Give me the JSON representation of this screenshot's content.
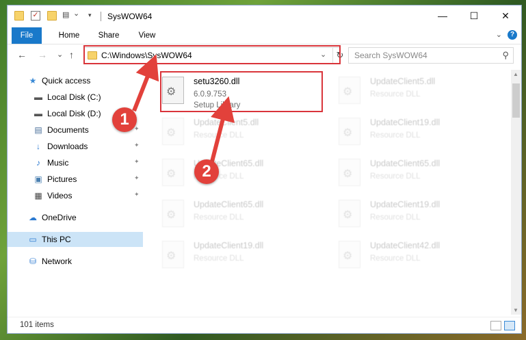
{
  "window": {
    "title": "SysWOW64",
    "minimize_glyph": "—",
    "maximize_glyph": "☐",
    "close_glyph": "✕"
  },
  "quick_access_toolbar": {
    "icons": [
      "folder-icon",
      "properties-check-icon",
      "new-folder-icon",
      "qat-dropdown-icon"
    ]
  },
  "ribbon": {
    "tabs": [
      "File",
      "Home",
      "Share",
      "View"
    ],
    "help_glyph": "?"
  },
  "navigation": {
    "back_glyph": "←",
    "forward_glyph": "→",
    "recent_glyph": "⌄",
    "up_glyph": "↑"
  },
  "address_bar": {
    "path": "C:\\Windows\\SysWOW64",
    "dropdown_glyph": "⌄",
    "refresh_glyph": "↻"
  },
  "search": {
    "placeholder": "Search SysWOW64",
    "icon_glyph": "⚲"
  },
  "sidebar": {
    "items": [
      {
        "label": "Quick access",
        "icon": "star-icon",
        "glyph": "★",
        "color": "#3a8ad6"
      },
      {
        "label": "Local Disk (C:)",
        "icon": "drive-icon",
        "glyph": "▬",
        "color": "#555555"
      },
      {
        "label": "Local Disk (D:)",
        "icon": "drive-icon",
        "glyph": "▬",
        "color": "#555555"
      },
      {
        "label": "Documents",
        "icon": "documents-icon",
        "glyph": "▤",
        "color": "#4a6f9a"
      },
      {
        "label": "Downloads",
        "icon": "download-icon",
        "glyph": "↓",
        "color": "#2b79d0"
      },
      {
        "label": "Music",
        "icon": "music-icon",
        "glyph": "♪",
        "color": "#2b79d0"
      },
      {
        "label": "Pictures",
        "icon": "pictures-icon",
        "glyph": "▣",
        "color": "#4a7fb0"
      },
      {
        "label": "Videos",
        "icon": "videos-icon",
        "glyph": "▦",
        "color": "#444444"
      },
      {
        "label": "OneDrive",
        "icon": "cloud-icon",
        "glyph": "☁",
        "color": "#2b79d0"
      },
      {
        "label": "This PC",
        "icon": "computer-icon",
        "glyph": "▭",
        "color": "#2b79d0"
      },
      {
        "label": "Network",
        "icon": "network-icon",
        "glyph": "⛁",
        "color": "#2b79d0"
      }
    ],
    "pin_glyph": "✦"
  },
  "files": [
    {
      "name": "setu3260.dll",
      "line2": "6.0.9.753",
      "line3": "Setup Library",
      "faded": false
    },
    {
      "name": "UpdateClient5.dll",
      "line2": "Resource DLL",
      "line3": "",
      "faded": true
    },
    {
      "name": "UpdateClient5.dll",
      "line2": "Resource DLL",
      "line3": "",
      "faded": true
    },
    {
      "name": "UpdateClient19.dll",
      "line2": "Resource DLL",
      "line3": "",
      "faded": true
    },
    {
      "name": "UpdateClient65.dll",
      "line2": "Resource DLL",
      "line3": "",
      "faded": true
    },
    {
      "name": "UpdateClient65.dll",
      "line2": "Resource DLL",
      "line3": "",
      "faded": true
    },
    {
      "name": "UpdateClient65.dll",
      "line2": "Resource DLL",
      "line3": "",
      "faded": true
    },
    {
      "name": "UpdateClient19.dll",
      "line2": "Resource DLL",
      "line3": "",
      "faded": true
    },
    {
      "name": "UpdateClient19.dll",
      "line2": "Resource DLL",
      "line3": "",
      "faded": true
    },
    {
      "name": "UpdateClient42.dll",
      "line2": "Resource DLL",
      "line3": "",
      "faded": true
    }
  ],
  "file_icon_glyph": "⚙",
  "status_bar": {
    "item_count": "101 items"
  },
  "annotations": {
    "callout_1": "1",
    "callout_2": "2",
    "highlight_color": "#d9343a"
  }
}
